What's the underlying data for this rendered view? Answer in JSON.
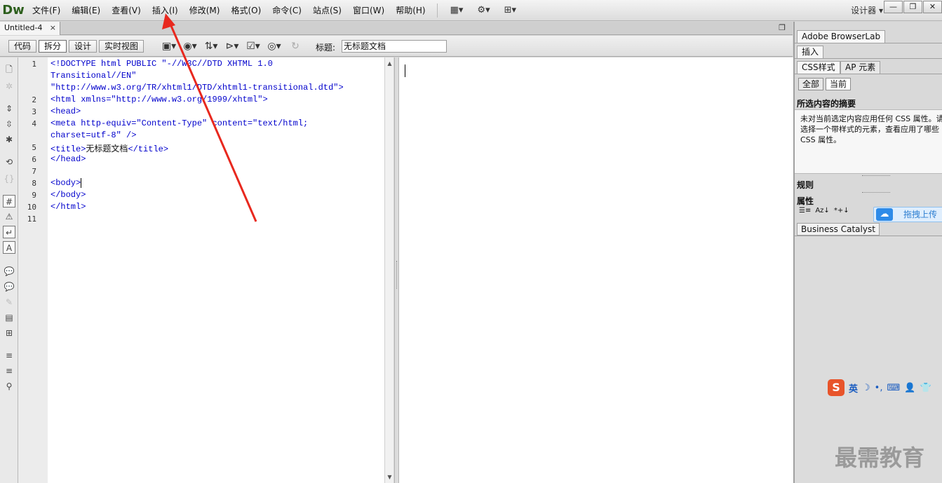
{
  "app": {
    "logo": "Dw",
    "workspace_label": "设计器",
    "workspace_arrow": "▾"
  },
  "menu": {
    "items": [
      "文件(F)",
      "编辑(E)",
      "查看(V)",
      "插入(I)",
      "修改(M)",
      "格式(O)",
      "命令(C)",
      "站点(S)",
      "窗口(W)",
      "帮助(H)"
    ],
    "icons": [
      "layout-icon",
      "gear-icon",
      "site-icon"
    ]
  },
  "window_buttons": {
    "minimize": "—",
    "restore": "❐",
    "close": "✕"
  },
  "document": {
    "tab_name": "Untitled-4",
    "tab_close": "×",
    "view_buttons": [
      "代码",
      "拆分",
      "设计",
      "实时视图"
    ],
    "active_view": "拆分",
    "title_label": "标题:",
    "title_value": "无标题文档"
  },
  "code": {
    "lines": [
      {
        "num": "1",
        "text": "<!DOCTYPE html PUBLIC \"-//W3C//DTD XHTML 1.0"
      },
      {
        "num": "",
        "text": "Transitional//EN\""
      },
      {
        "num": "",
        "text": "\"http://www.w3.org/TR/xhtml1/DTD/xhtml1-transitional.dtd\">"
      },
      {
        "num": "2",
        "text": "<html xmlns=\"http://www.w3.org/1999/xhtml\">"
      },
      {
        "num": "3",
        "text": "<head>"
      },
      {
        "num": "4",
        "text": "<meta http-equiv=\"Content-Type\" content=\"text/html;"
      },
      {
        "num": "",
        "text": "charset=utf-8\" />"
      },
      {
        "num": "5",
        "text": "<title>"
      },
      {
        "num": "6",
        "text": "</head>"
      },
      {
        "num": "7",
        "text": ""
      },
      {
        "num": "8",
        "text": "<body>"
      },
      {
        "num": "9",
        "text": "</body>"
      },
      {
        "num": "10",
        "text": "</html>"
      },
      {
        "num": "11",
        "text": ""
      }
    ],
    "title_inner_text": "无标题文档",
    "title_close_tag": "</title>"
  },
  "right_panel": {
    "browserlab_tab": "Adobe BrowserLab",
    "insert_tab": "插入",
    "css_tab": "CSS样式",
    "ap_tab": "AP 元素",
    "all_btn": "全部",
    "current_btn": "当前",
    "summary_heading": "所选内容的摘要",
    "summary_text": "未对当前选定内容应用任何 CSS 属性。请选择一个带样式的元素，查看应用了哪些 CSS 属性。",
    "rules_heading": "规则",
    "props_heading": "属性",
    "prop_icons": [
      "☰≡",
      "Az↓",
      "*+↓"
    ],
    "upload_label": "拖拽上传",
    "bc_tab": "Business Catalyst"
  },
  "ime": {
    "logo": "S",
    "lang": "英",
    "glyphs": [
      "☽",
      "•,",
      "⌨",
      "👤",
      "👕"
    ]
  },
  "watermark": "最需教育",
  "colors": {
    "code_blue": "#0000cc",
    "arrow_red": "#e8281e",
    "upload_blue": "#2e8be8"
  }
}
